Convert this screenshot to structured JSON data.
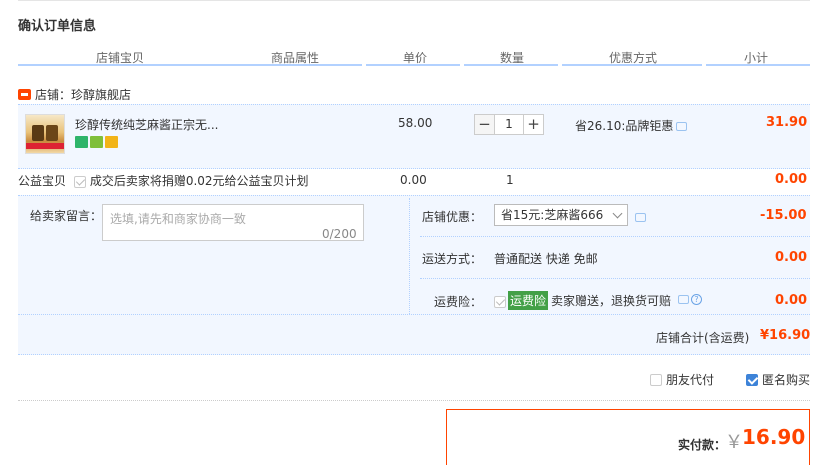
{
  "section_title": "确认订单信息",
  "headers": [
    "店铺宝贝",
    "商品属性",
    "单价",
    "数量",
    "优惠方式",
    "小计"
  ],
  "shop": {
    "label": "店铺：",
    "name": "珍醇旗舰店"
  },
  "item": {
    "name": "珍醇传统纯芝麻酱正宗无...",
    "price": "58.00",
    "quantity": "1",
    "qty_minus": "−",
    "qty_plus": "+",
    "promotion": "省26.10:品牌钜惠",
    "subtotal": "31.90"
  },
  "gongyi": {
    "label": "公益宝贝",
    "desc": "成交后卖家将捐赠0.02元给公益宝贝计划",
    "price": "0.00",
    "quantity": "1",
    "total": "0.00"
  },
  "message": {
    "label": "给卖家留言：",
    "placeholder": "选填,请先和商家协商一致",
    "count": "0/200"
  },
  "coupon": {
    "label": "店铺优惠：",
    "selected": "省15元:芝麻酱666",
    "amount": "-15.00"
  },
  "shipping": {
    "label": "运送方式：",
    "value": "普通配送 快递 免邮",
    "amount": "0.00"
  },
  "insurance": {
    "label": "运费险：",
    "badge": "运费险",
    "desc": "卖家赠送，退换货可赔",
    "amount": "0.00"
  },
  "shop_total": {
    "label": "店铺合计(含运费)",
    "value": "¥16.90"
  },
  "options": {
    "friend_pay": "朋友代付",
    "anonymous": "匿名购买"
  },
  "payment": {
    "label": "实付款：",
    "currency": "￥",
    "amount": "16.90"
  },
  "colors": {
    "accent": "#ff4400",
    "light_blue_bg": "#f2f7ff",
    "header_line": "#b2d1ff",
    "insurance_green": "#43a047"
  }
}
